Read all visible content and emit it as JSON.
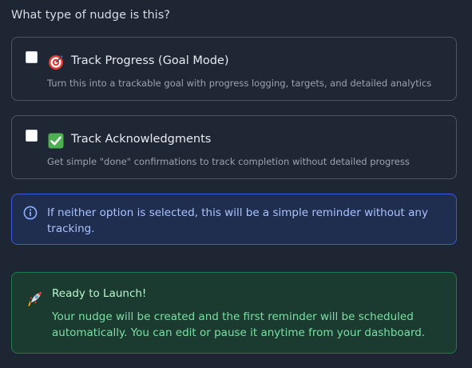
{
  "question": "What type of nudge is this?",
  "options": [
    {
      "title": "Track Progress (Goal Mode)",
      "description": "Turn this into a trackable goal with progress logging, targets, and detailed analytics",
      "checked": false,
      "icon": "target-icon"
    },
    {
      "title": "Track Acknowledgments",
      "description": "Get simple \"done\" confirmations to track completion without detailed progress",
      "checked": false,
      "icon": "check-mark-icon"
    }
  ],
  "info": {
    "text": "If neither option is selected, this will be a simple reminder without any tracking.",
    "icon": "info-icon"
  },
  "launch": {
    "title": "Ready to Launch!",
    "text": "Your nudge will be created and the first reminder will be scheduled automatically. You can edit or pause it anytime from your dashboard.",
    "icon": "rocket-icon"
  },
  "colors": {
    "background": "#1e2533",
    "info_border": "#3b5bdb",
    "info_text": "#aac4ff",
    "launch_border": "#1f7a4a",
    "launch_text": "#79e0a3"
  }
}
